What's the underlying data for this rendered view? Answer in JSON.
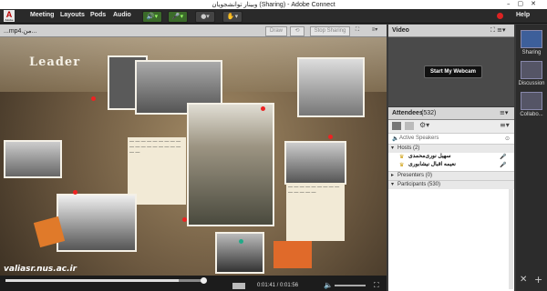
{
  "window": {
    "title": "وبینار توانشجویان (Sharing) - Adobe Connect"
  },
  "menu": {
    "items": [
      "Meeting",
      "Layouts",
      "Pods",
      "Audio"
    ]
  },
  "top_right": {
    "help": "Help"
  },
  "share_pod": {
    "title": "...mp4.من...",
    "buttons": {
      "draw": "Draw",
      "stop": "Stop Sharing"
    },
    "overlay_text": "Leader",
    "watermark": "valiasr.nus.ac.ir",
    "time": "0:01:41 / 0:01:56",
    "progress": 0.87
  },
  "video_pod": {
    "title": "Video",
    "start_webcam": "Start My Webcam"
  },
  "attendees": {
    "title": "Attendees",
    "count": "(532)",
    "active_speakers": "Active Speakers",
    "hosts_label": "Hosts (2)",
    "hosts": [
      "سهیل نوری‌محمدی",
      "نعیمه اقبال نیشابوری"
    ],
    "presenters_label": "Presenters (0)",
    "participants_label": "Participants (530)"
  },
  "sidebar": {
    "items": [
      "Sharing",
      "Discussion",
      "Collabo..."
    ]
  },
  "colors": {
    "record": "#dd2222",
    "pod_header": "#d0d0d0",
    "sidebar": "#2c2c2c"
  }
}
